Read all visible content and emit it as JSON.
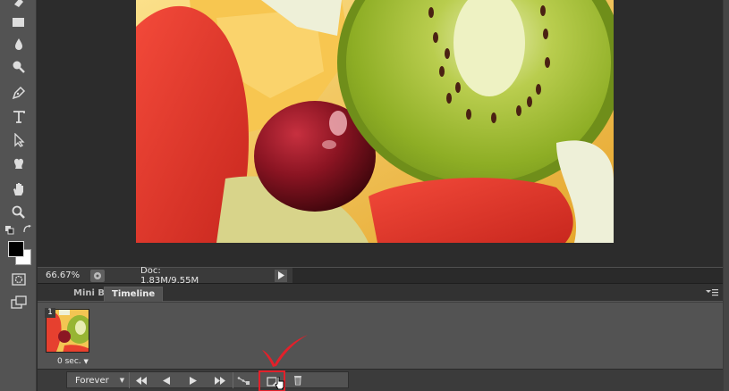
{
  "status": {
    "zoom": "66.67%",
    "doc_info": "Doc: 1.83M/9.55M"
  },
  "panel": {
    "tabs": [
      {
        "label": "Mini Bridge",
        "active": false
      },
      {
        "label": "Timeline",
        "active": true
      }
    ]
  },
  "frame": {
    "number": "1",
    "delay": "0 sec."
  },
  "controls": {
    "loop_label": "Forever"
  },
  "colors": {
    "ui_panel": "#535353",
    "highlight": "#e3202a",
    "foreground_swatch": "#000000",
    "background_swatch": "#ffffff"
  },
  "icons": [
    "eraser-icon",
    "rectangle-icon",
    "blur-drop-icon",
    "dodge-icon",
    "pen-icon",
    "type-icon",
    "path-select-icon",
    "custom-shape-icon",
    "hand-icon",
    "zoom-icon",
    "quick-mask-icon",
    "screen-mode-icon"
  ]
}
